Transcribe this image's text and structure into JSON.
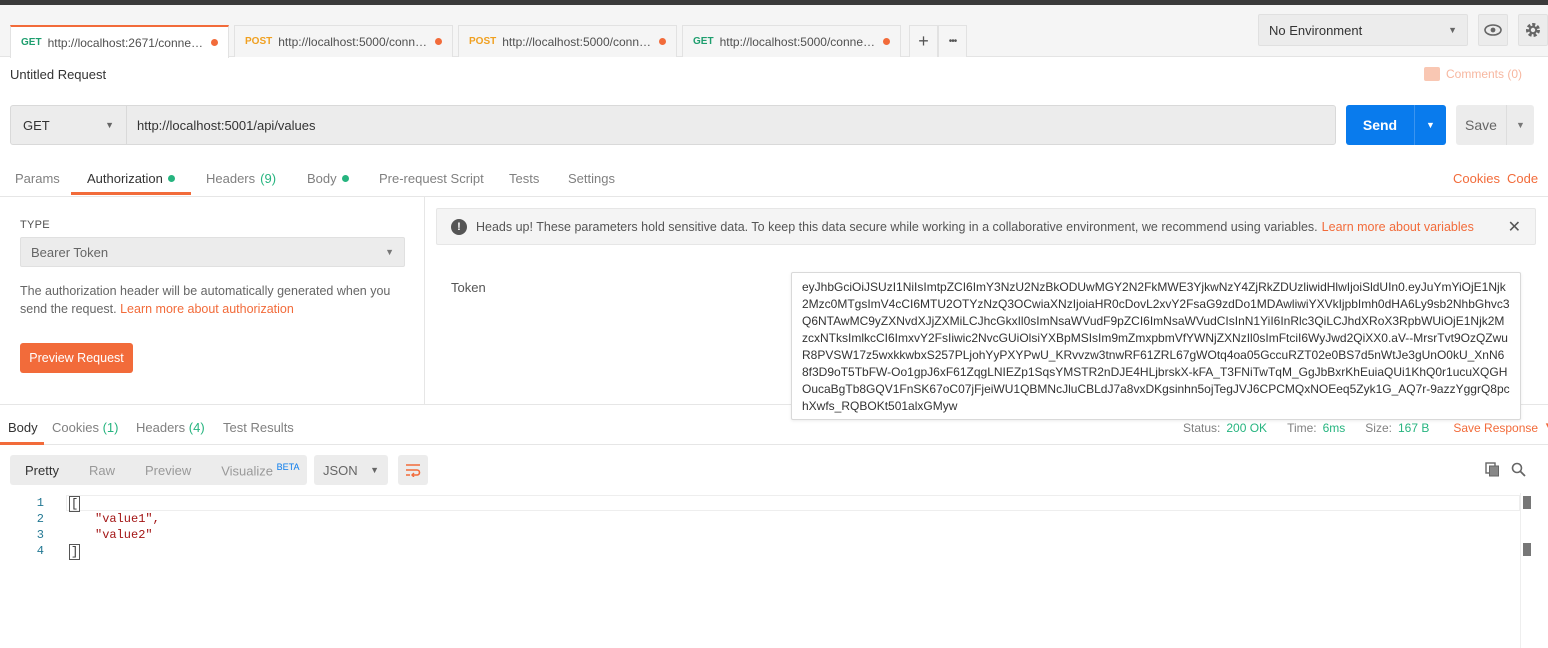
{
  "tabs": [
    {
      "method": "GET",
      "url": "http://localhost:2671/connect/t...",
      "modified": true,
      "active": true
    },
    {
      "method": "POST",
      "url": "http://localhost:5000/connect/...",
      "modified": true,
      "active": false
    },
    {
      "method": "POST",
      "url": "http://localhost:5000/connect/...",
      "modified": true,
      "active": false
    },
    {
      "method": "GET",
      "url": "http://localhost:5000/connect/u...",
      "modified": true,
      "active": false
    }
  ],
  "tabbar": {
    "add_symbol": "+",
    "more_symbol": "•••"
  },
  "environment": {
    "selected": "No Environment"
  },
  "request": {
    "title": "Untitled Request",
    "comments_label": "Comments (0)",
    "method": "GET",
    "url": "http://localhost:5001/api/values",
    "send_label": "Send",
    "save_label": "Save"
  },
  "request_tabs": {
    "params": "Params",
    "authorization": "Authorization",
    "headers": "Headers",
    "headers_count": "(9)",
    "body": "Body",
    "pre_request": "Pre-request Script",
    "tests": "Tests",
    "settings": "Settings",
    "cookies": "Cookies",
    "code": "Code"
  },
  "auth": {
    "type_label": "TYPE",
    "type_value": "Bearer Token",
    "description": "The authorization header will be automatically generated when you send the request.",
    "learn_more": "Learn more about authorization",
    "preview_button": "Preview Request",
    "warning_text": "Heads up! These parameters hold sensitive data. To keep this data secure while working in a collaborative environment, we recommend using variables.",
    "warning_link": "Learn more about variables",
    "token_label": "Token",
    "token_value": "eyJhbGciOiJSUzI1NiIsImtpZCI6ImY3NzU2NzBkODUwMGY2N2FkMWE3YjkwNzY4ZjRkZDUzliwidHlwIjoiSldUIn0.eyJuYmYiOjE1Njk2Mzc0MTgsImV4cCI6MTU2OTYzNzQ3OCwiaXNzIjoiaHR0cDovL2xvY2FsaG9zdDo1MDAwliwiYXVkIjpbImh0dHA6Ly9sb2NhbGhvc3Q6NTAwMC9yZXNvdXJjZXMiLCJhcGkxIl0sImNsaWVudF9pZCI6ImNsaWVudCIsInN1YiI6InRlc3QiLCJhdXRoX3RpbWUiOjE1Njk2MzcxNTksImlkcCI6ImxvY2FsIiwic2NvcGUiOlsiYXBpMSIsIm9mZmxpbmVfYWNjZXNzIl0sImFtciI6WyJwd2QiXX0.aV--MrsrTvt9OzQZwuR8PVSW17z5wxkkwbxS257PLjohYyPXYPwU_KRvvzw3tnwRF61ZRL67gWOtq4oa05GccuRZT02e0BS7d5nWtJe3gUnO0kU_XnN68f3D9oT5TbFW-Oo1gpJ6xF61ZqgLNIEZp1SqsYMSTR2nDJE4HLjbrskX-kFA_T3FNiTwTqM_GgJbBxrKhEuiaQUi1KhQ0r1ucuXQGHOucaBgTb8GQV1FnSK67oC07jFjeiWU1QBMNcJluCBLdJ7a8vxDKgsinhn5ojTegJVJ6CPCMQxNOEeq5Zyk1G_AQ7r-9azzYggrQ8pchXwfs_RQBOKt501alxGMyw"
  },
  "response": {
    "tabs": {
      "body": "Body",
      "cookies": "Cookies",
      "cookies_count": "(1)",
      "headers": "Headers",
      "headers_count": "(4)",
      "test_results": "Test Results"
    },
    "status_label": "Status:",
    "status_value": "200 OK",
    "time_label": "Time:",
    "time_value": "6ms",
    "size_label": "Size:",
    "size_value": "167 B",
    "save_response": "Save Response",
    "views": {
      "pretty": "Pretty",
      "raw": "Raw",
      "preview": "Preview",
      "visualize": "Visualize",
      "beta": "BETA"
    },
    "format": "JSON",
    "lines": [
      {
        "n": "1",
        "text": "["
      },
      {
        "n": "2",
        "text": "\"value1\","
      },
      {
        "n": "3",
        "text": "\"value2\""
      },
      {
        "n": "4",
        "text": "]"
      }
    ]
  },
  "colors": {
    "accent": "#f26b3a",
    "send": "#097bed",
    "success": "#26b47f"
  }
}
